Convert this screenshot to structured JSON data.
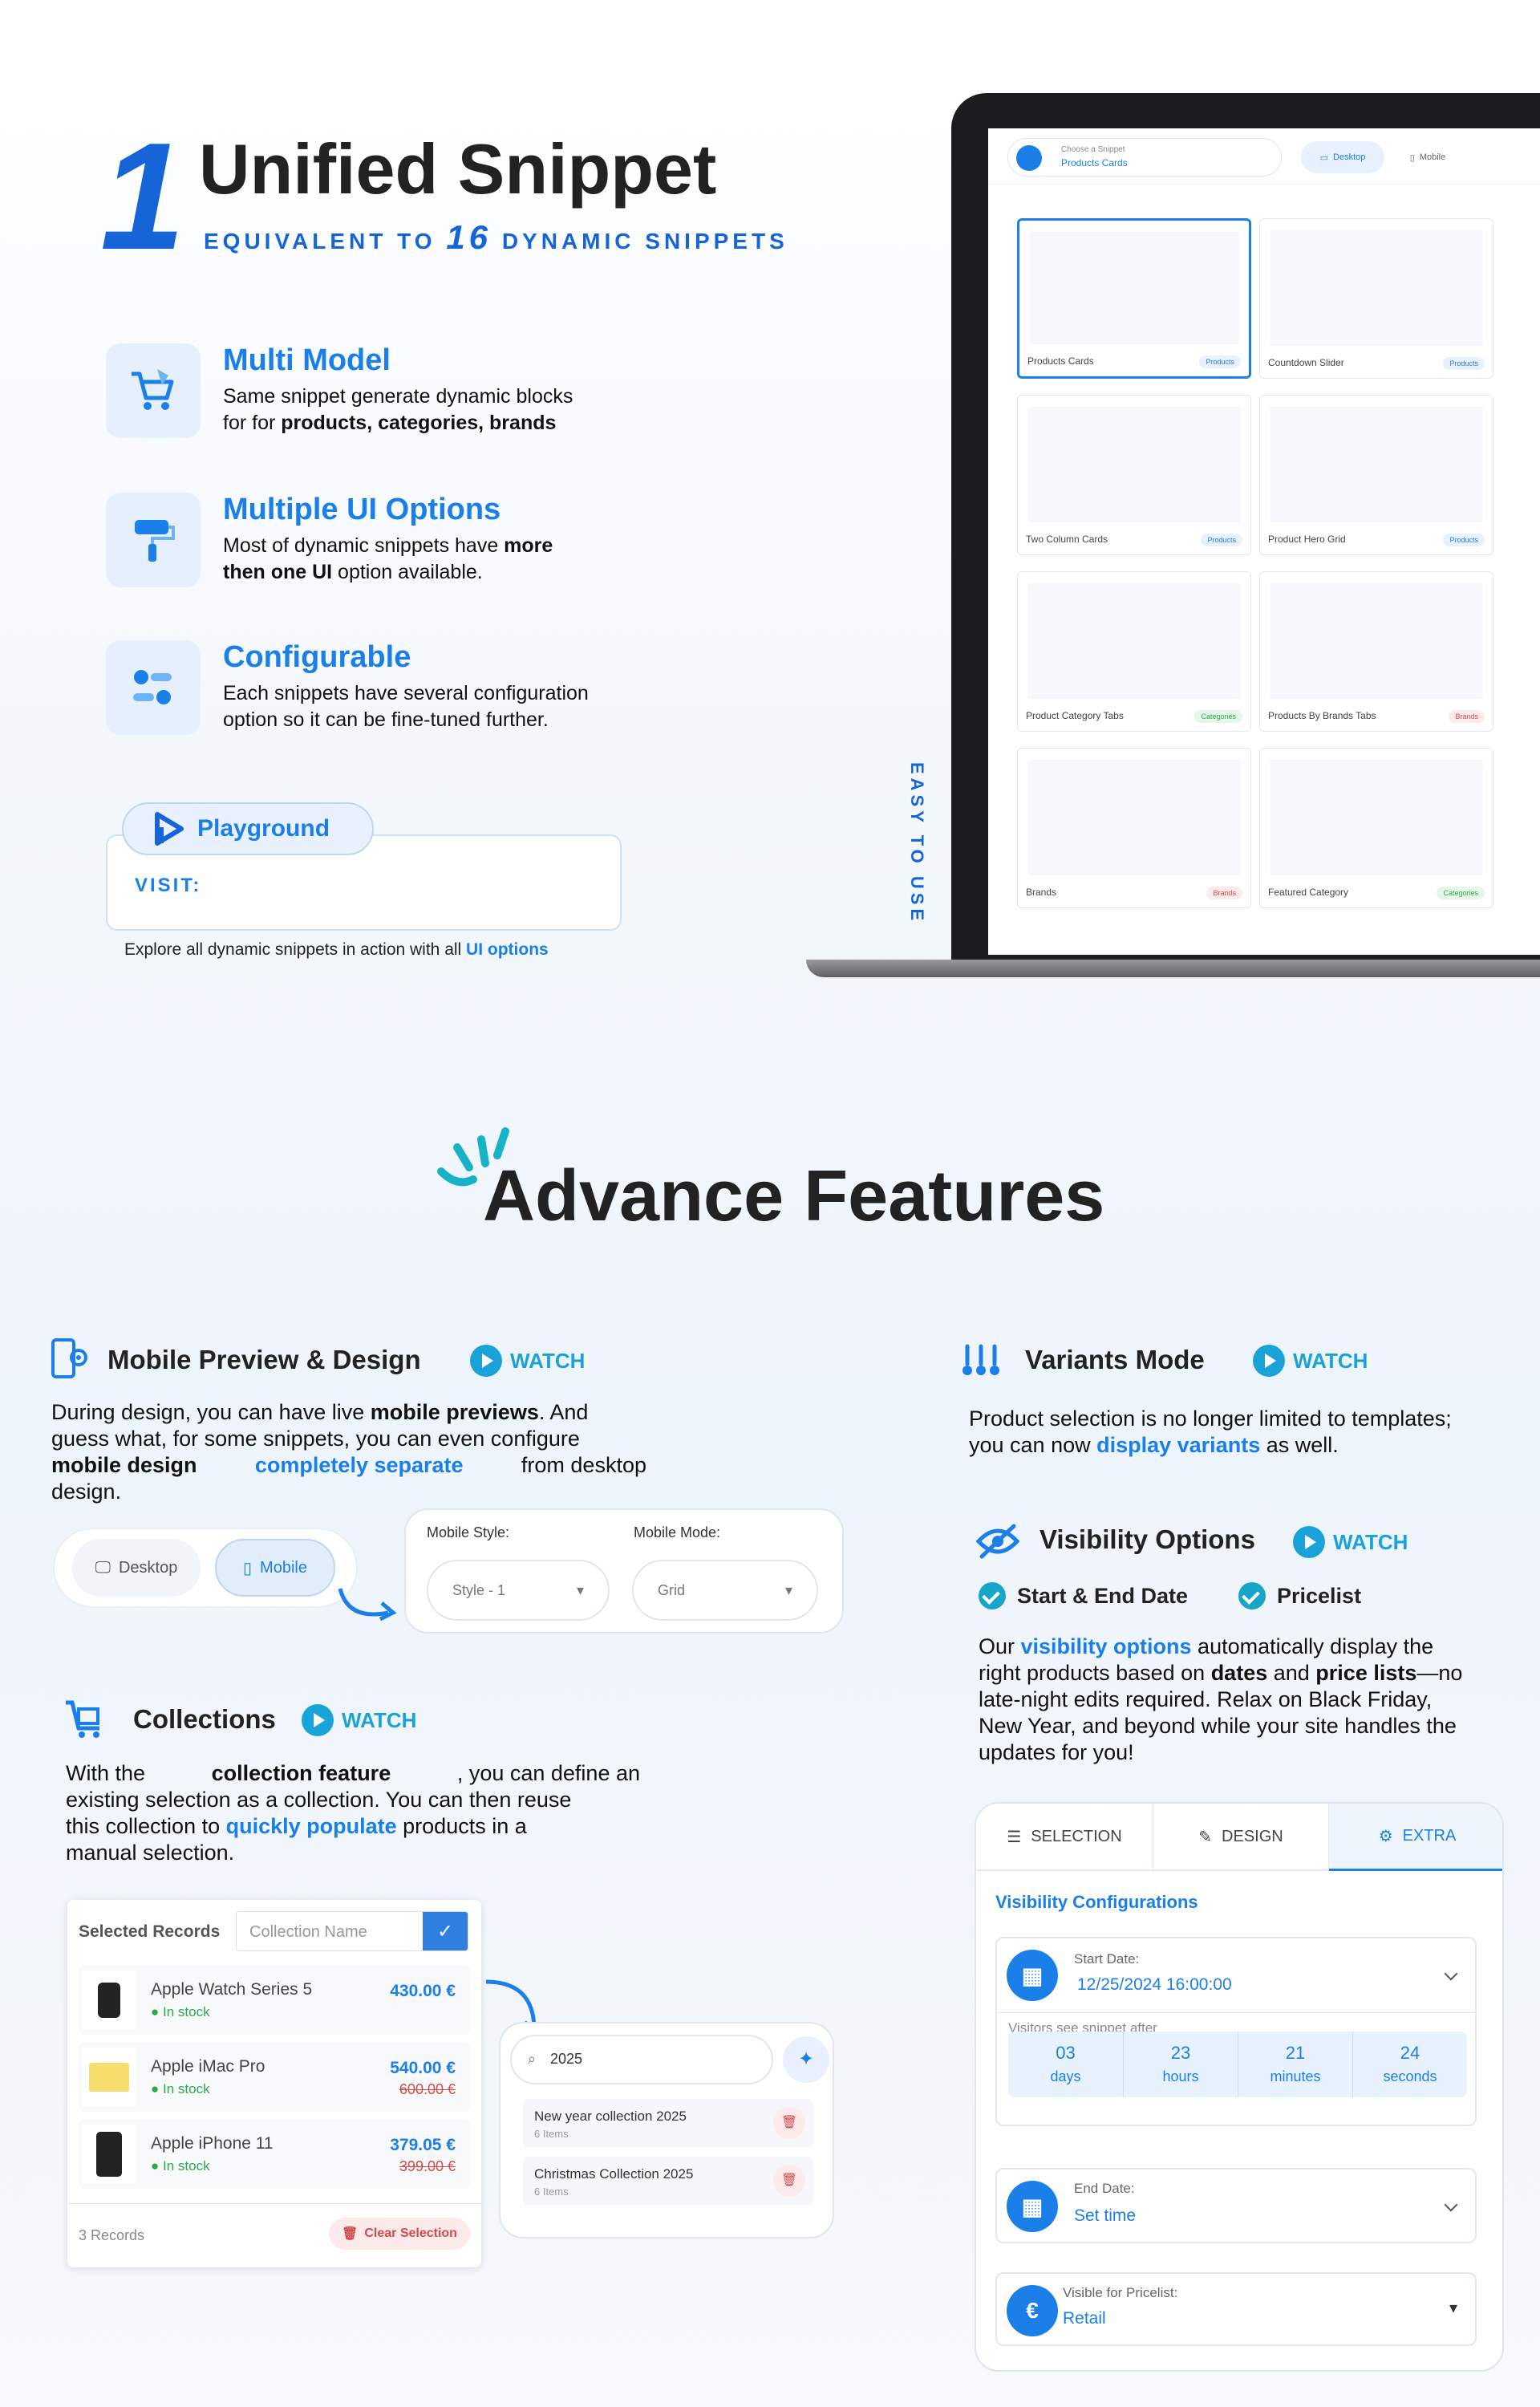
{
  "hero": {
    "number": "1",
    "title": "Unified Snippet",
    "subtitle_prefix": "EQUIVALENT TO",
    "subtitle_number": "16",
    "subtitle_suffix": "DYNAMIC SNIPPETS"
  },
  "features": [
    {
      "title": "Multi Model",
      "line1": "Same snippet generate dynamic blocks",
      "line2_prefix": "for for ",
      "line2_bold": "products, categories, brands",
      "icon": "cart-icon"
    },
    {
      "title": "Multiple UI Options",
      "line1_prefix": "Most of dynamic snippets have ",
      "line1_bold": "more",
      "line2_bold": "then one UI",
      "line2_suffix": " option available.",
      "icon": "paint-roller-icon"
    },
    {
      "title": "Configurable",
      "line1": "Each snippets have several configuration",
      "line2": "option so it can be fine-tuned further.",
      "icon": "toggle-icon"
    }
  ],
  "playground": {
    "label": "Playground",
    "visit": "VISIT:",
    "explore_prefix": "Explore all dynamic snippets in action with all ",
    "explore_link": "UI options"
  },
  "laptop": {
    "chooser_label": "Choose a Snippet",
    "chooser_value": "Products Cards",
    "desktop": "Desktop",
    "mobile": "Mobile",
    "cards": [
      {
        "name": "Products Cards",
        "badge": "Products"
      },
      {
        "name": "Countdown Slider",
        "badge": "Products"
      },
      {
        "name": "Two Column Cards",
        "badge": "Products"
      },
      {
        "name": "Product Hero Grid",
        "badge": "Products"
      },
      {
        "name": "Product Category Tabs",
        "badge": "Categories"
      },
      {
        "name": "Products By Brands Tabs",
        "badge": "Brands"
      },
      {
        "name": "Brands",
        "badge": "Brands"
      },
      {
        "name": "Featured Category",
        "badge": "Categories"
      }
    ],
    "easy": "EASY TO USE"
  },
  "advance": {
    "title": "Advance Features"
  },
  "mobile_preview": {
    "title": "Mobile Preview & Design",
    "watch": "WATCH",
    "p1": "During design, you can have live ",
    "p1b": "mobile previews",
    "p1c": ". And",
    "p2": "guess what, for some snippets, you can even configure",
    "p3b": "mobile design",
    "p3blue": "completely separate",
    "p3c": "from desktop",
    "p4": "design.",
    "desktop": "Desktop",
    "mobile": "Mobile",
    "style_label": "Mobile Style:",
    "style_value": "Style - 1",
    "mode_label": "Mobile Mode:",
    "mode_value": "Grid"
  },
  "collections": {
    "title": "Collections",
    "watch": "WATCH",
    "p1a": "With the ",
    "p1b": "collection feature",
    "p1c": ", you can define an",
    "p2": "existing selection as a collection. You can then reuse",
    "p3a": "this collection to ",
    "p3blue": "quickly populate",
    "p3c": " products in a",
    "p4": "manual selection.",
    "selected_records": "Selected Records",
    "placeholder": "Collection Name",
    "items": [
      {
        "name": "Apple Watch Series 5",
        "stock": "In stock",
        "price": "430.00 €",
        "old": ""
      },
      {
        "name": "Apple iMac Pro",
        "stock": "In stock",
        "price": "540.00 €",
        "old": "600.00 €"
      },
      {
        "name": "Apple iPhone 11",
        "stock": "In stock",
        "price": "379.05 €",
        "old": "399.00 €"
      }
    ],
    "records": "3 Records",
    "clear": "Clear Selection",
    "search_value": "2025",
    "results": [
      {
        "name": "New year collection 2025",
        "count": "6 Items"
      },
      {
        "name": "Christmas Collection 2025",
        "count": "6 Items"
      }
    ]
  },
  "variants": {
    "title": "Variants Mode",
    "watch": "WATCH",
    "p1": "Product selection is no longer limited to templates;",
    "p2a": "you can now ",
    "p2blue": "display variants",
    "p2c": " as well."
  },
  "visibility": {
    "title": "Visibility Options",
    "watch": "WATCH",
    "check1": "Start & End Date",
    "check2": "Pricelist",
    "p1a": "Our ",
    "p1blue": "visibility options",
    "p1c": " automatically display the",
    "p2a": "right products based on ",
    "p2b": "dates",
    "p2c": " and ",
    "p2d": "price lists",
    "p2e": "—no",
    "p3": "late-night edits required. Relax on Black Friday,",
    "p4": "New Year, and beyond while your site handles the",
    "p5": "updates for you!",
    "tabs": [
      "SELECTION",
      "DESIGN",
      "EXTRA"
    ],
    "config_title": "Visibility Configurations",
    "start_label": "Start Date:",
    "start_value": "12/25/2024 16:00:00",
    "visitors": "Visitors see snippet after",
    "countdown": [
      {
        "n": "03",
        "u": "days"
      },
      {
        "n": "23",
        "u": "hours"
      },
      {
        "n": "21",
        "u": "minutes"
      },
      {
        "n": "24",
        "u": "seconds"
      }
    ],
    "end_label": "End Date:",
    "end_value": "Set time",
    "pricelist_label": "Visible for Pricelist:",
    "pricelist_value": "Retail",
    "euro": "€"
  }
}
